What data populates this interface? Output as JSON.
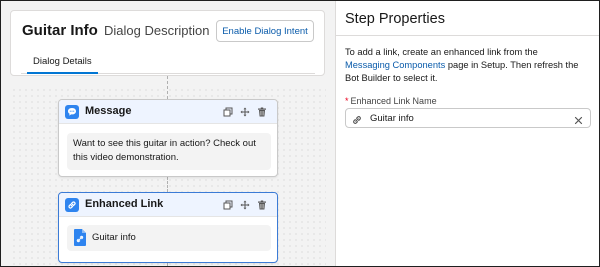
{
  "dialog": {
    "title": "Guitar Info",
    "description_tab": "Dialog Description",
    "enable_intent_label": "Enable Dialog Intent",
    "details_tab": "Dialog Details"
  },
  "steps": [
    {
      "title": "Message",
      "icon": "chat-icon",
      "text": "Want to see this guitar in action? Check out this video demonstration."
    },
    {
      "title": "Enhanced Link",
      "icon": "link-icon",
      "link_label": "Guitar info"
    }
  ],
  "step_properties": {
    "title": "Step Properties",
    "help_before": "To add a link, create an enhanced link from the ",
    "help_link": "Messaging Components",
    "help_after": " page in Setup. Then refresh the Bot Builder to select it.",
    "field_required_mark": "*",
    "field_label": "Enhanced Link Name",
    "field_value": "Guitar info"
  },
  "colors": {
    "accent": "#0176d3",
    "link": "#0b5cab",
    "badge": "#2e84ef",
    "required": "#ea001e"
  }
}
